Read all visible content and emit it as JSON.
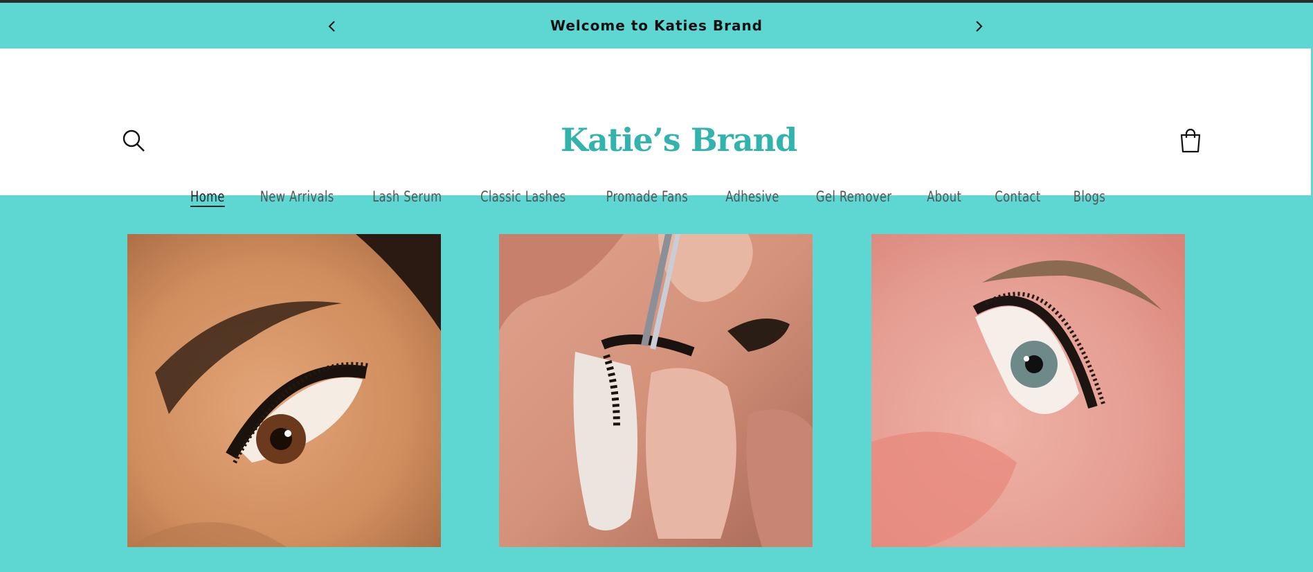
{
  "announcement": {
    "text": "Welcome to Katies Brand"
  },
  "header": {
    "logo_text": "Katie’s Brand"
  },
  "nav": {
    "items": [
      {
        "label": "Home"
      },
      {
        "label": "New Arrivals"
      },
      {
        "label": "Lash Serum"
      },
      {
        "label": "Classic Lashes"
      },
      {
        "label": "Promade Fans"
      },
      {
        "label": "Adhesive"
      },
      {
        "label": "Gel Remover"
      },
      {
        "label": "About"
      },
      {
        "label": "Contact"
      },
      {
        "label": "Blogs"
      }
    ]
  },
  "colors": {
    "accent": "#5ed6d2",
    "logo": "#32b3ad"
  },
  "icons": [
    "chevron-left-icon",
    "chevron-right-icon",
    "search-icon",
    "cart-icon"
  ]
}
